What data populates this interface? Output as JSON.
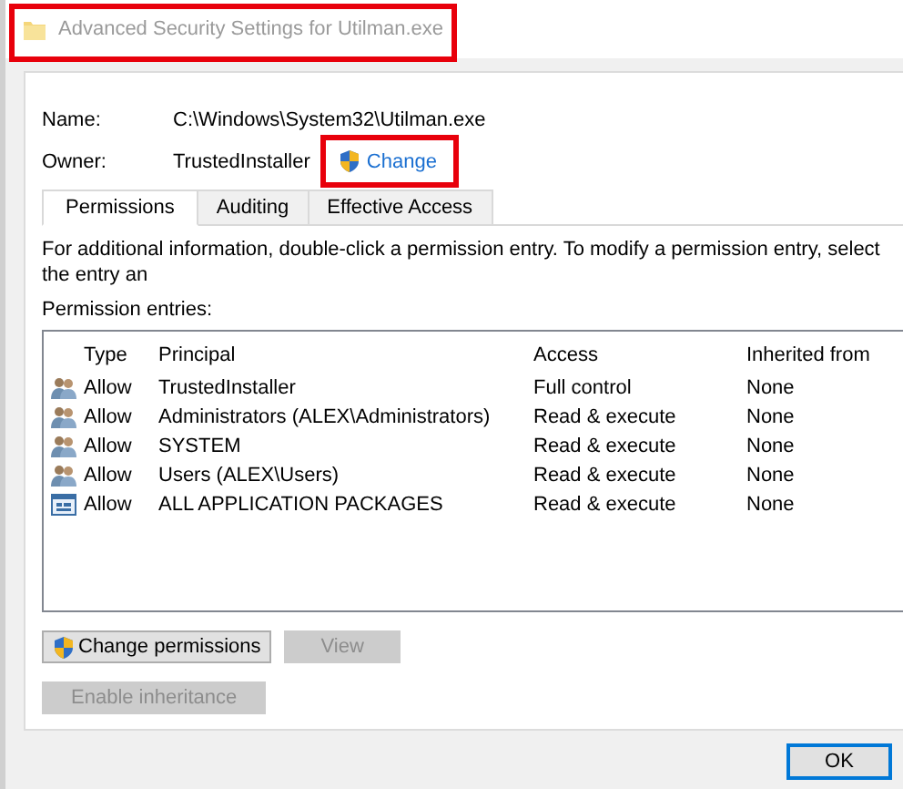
{
  "window": {
    "title": "Advanced Security Settings for Utilman.exe"
  },
  "fields": [
    {
      "label": "Name:",
      "value": "C:\\Windows\\System32\\Utilman.exe"
    },
    {
      "label": "Owner:",
      "value": "TrustedInstaller",
      "link": "Change"
    }
  ],
  "tabs": [
    {
      "label": "Permissions",
      "selected": true
    },
    {
      "label": "Auditing",
      "selected": false
    },
    {
      "label": "Effective Access",
      "selected": false
    }
  ],
  "info_text": "For additional information, double-click a permission entry. To modify a permission entry, select the entry an",
  "entries_label": "Permission entries:",
  "table": {
    "columns": [
      "Type",
      "Principal",
      "Access",
      "Inherited from"
    ],
    "rows": [
      {
        "kind": "user",
        "type": "Allow",
        "principal": "TrustedInstaller",
        "access": "Full control",
        "inherited": "None"
      },
      {
        "kind": "user",
        "type": "Allow",
        "principal": "Administrators (ALEX\\Administrators)",
        "access": "Read & execute",
        "inherited": "None"
      },
      {
        "kind": "user",
        "type": "Allow",
        "principal": "SYSTEM",
        "access": "Read & execute",
        "inherited": "None"
      },
      {
        "kind": "user",
        "type": "Allow",
        "principal": "Users (ALEX\\Users)",
        "access": "Read & execute",
        "inherited": "None"
      },
      {
        "kind": "app",
        "type": "Allow",
        "principal": "ALL APPLICATION PACKAGES",
        "access": "Read & execute",
        "inherited": "None"
      }
    ]
  },
  "buttons": [
    {
      "label": "Change permissions",
      "shield": true,
      "disabled": false
    },
    {
      "label": "View",
      "shield": false,
      "disabled": true
    }
  ],
  "inheritance_button": {
    "label": "Enable inheritance",
    "disabled": true
  },
  "ok_button": {
    "label": "OK"
  }
}
